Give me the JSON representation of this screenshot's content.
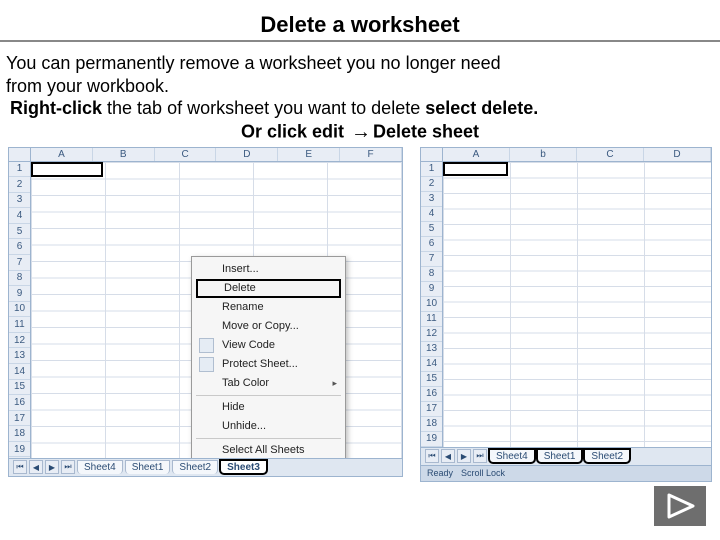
{
  "title": "Delete a worksheet",
  "body": {
    "line1": "You can permanently remove a worksheet you no longer need",
    "line2": "from your workbook.",
    "line3_prefix": "Right-click",
    "line3_mid": " the tab of worksheet you want to delete ",
    "line3_suffix": "select delete.",
    "line4_pre": "Or click edit ",
    "line4_post": "Delete sheet"
  },
  "left": {
    "columns": [
      "A",
      "B",
      "C",
      "D",
      "E",
      "F"
    ],
    "row_count": 19,
    "context_menu": {
      "insert": "Insert...",
      "delete": "Delete",
      "rename": "Rename",
      "move_copy": "Move or Copy...",
      "view_code": "View Code",
      "protect": "Protect Sheet...",
      "tab_color": "Tab Color",
      "hide": "Hide",
      "unhide": "Unhide...",
      "select_all": "Select All Sheets"
    },
    "tabs": [
      "Sheet4",
      "Sheet1",
      "Sheet2",
      "Sheet3"
    ],
    "active_tab_index": 3
  },
  "right": {
    "columns": [
      "A",
      "b",
      "C",
      "D"
    ],
    "row_count": 19,
    "tabs": [
      "Sheet4",
      "Sheet1",
      "Sheet2"
    ],
    "highlighted_tab_indices": [
      0,
      1,
      2
    ],
    "status": {
      "ready": "Ready",
      "scroll": "Scroll Lock"
    }
  },
  "icons": {
    "play": "play-icon",
    "arrow": "→"
  }
}
